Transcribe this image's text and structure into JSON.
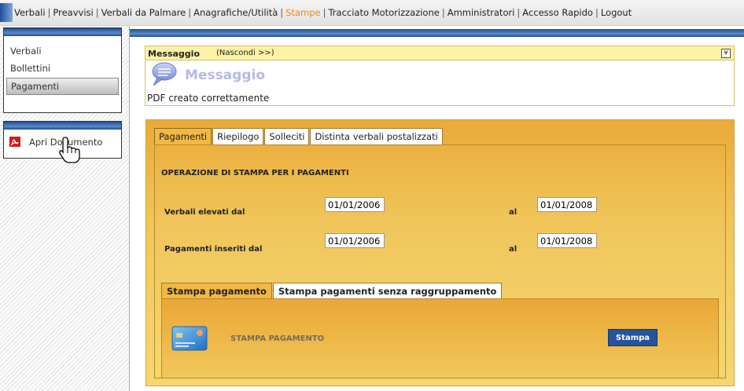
{
  "topnav": {
    "items": [
      "Verbali",
      "Preavvisi",
      "Verbali da Palmare",
      "Anagrafiche/Utilità",
      "Stampe",
      "Tracciato Motorizzazione",
      "Amministratori",
      "Accesso Rapido",
      "Logout"
    ],
    "active": "Stampe",
    "separator": "|"
  },
  "sidebar": {
    "menu": [
      "Verbali",
      "Bollettini",
      "Pagamenti"
    ],
    "selected": "Pagamenti",
    "document_link": "Apri Documento"
  },
  "message": {
    "header_title": "Messaggio",
    "hide_link": "(Nascondi >>)",
    "collapse_glyph": "¥",
    "big_title": "Messaggio",
    "text": "PDF creato correttamente"
  },
  "tabs": [
    "Pagamenti",
    "Riepilogo",
    "Solleciti",
    "Distinta verbali postalizzati"
  ],
  "form": {
    "title": "OPERAZIONE DI STAMPA PER I PAGAMENTI",
    "row1": {
      "label": "Verbali elevati dal",
      "from": "01/01/2006",
      "to_label": "al",
      "to": "01/01/2008"
    },
    "row2": {
      "label": "Pagamenti inseriti dal",
      "from": "01/01/2006",
      "to_label": "al",
      "to": "01/01/2008"
    }
  },
  "subtabs": [
    "Stampa pagamento",
    "Stampa pagamenti senza raggruppamento"
  ],
  "print": {
    "label": "STAMPA PAGAMENTO",
    "button": "Stampa"
  },
  "colors": {
    "nav_active": "#f08a1c",
    "panel_blue": "#1f4d94",
    "orange": "#f0c65b",
    "button_blue": "#25539c"
  },
  "icons": {
    "pdf": "pdf-icon",
    "pointer": "hand-pointer-icon",
    "message": "speech-bubble-icon",
    "card": "credit-card-icon"
  }
}
